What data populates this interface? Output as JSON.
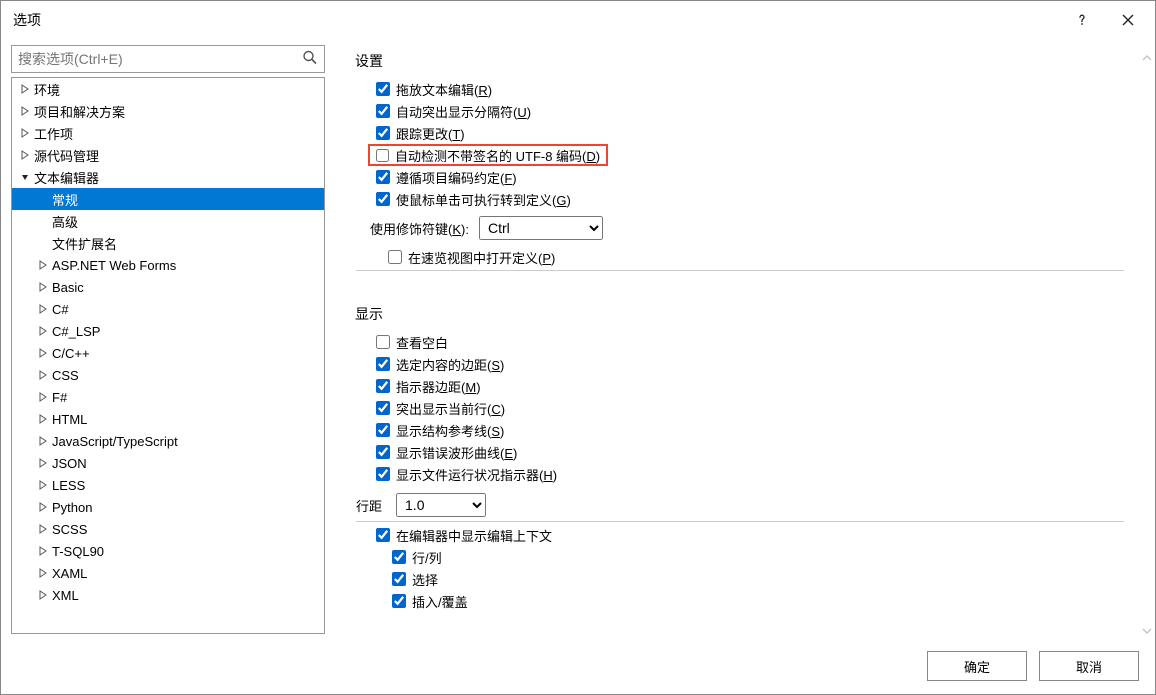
{
  "title": "选项",
  "search_placeholder": "搜索选项(Ctrl+E)",
  "tree": [
    {
      "label": "环境",
      "depth": 0,
      "expand": "closed"
    },
    {
      "label": "项目和解决方案",
      "depth": 0,
      "expand": "closed"
    },
    {
      "label": "工作项",
      "depth": 0,
      "expand": "closed"
    },
    {
      "label": "源代码管理",
      "depth": 0,
      "expand": "closed"
    },
    {
      "label": "文本编辑器",
      "depth": 0,
      "expand": "open"
    },
    {
      "label": "常规",
      "depth": 1,
      "expand": "none",
      "selected": true
    },
    {
      "label": "高级",
      "depth": 1,
      "expand": "none"
    },
    {
      "label": "文件扩展名",
      "depth": 1,
      "expand": "none"
    },
    {
      "label": "ASP.NET Web Forms",
      "depth": 1,
      "expand": "closed"
    },
    {
      "label": "Basic",
      "depth": 1,
      "expand": "closed"
    },
    {
      "label": "C#",
      "depth": 1,
      "expand": "closed"
    },
    {
      "label": "C#_LSP",
      "depth": 1,
      "expand": "closed"
    },
    {
      "label": "C/C++",
      "depth": 1,
      "expand": "closed"
    },
    {
      "label": "CSS",
      "depth": 1,
      "expand": "closed"
    },
    {
      "label": "F#",
      "depth": 1,
      "expand": "closed"
    },
    {
      "label": "HTML",
      "depth": 1,
      "expand": "closed"
    },
    {
      "label": "JavaScript/TypeScript",
      "depth": 1,
      "expand": "closed"
    },
    {
      "label": "JSON",
      "depth": 1,
      "expand": "closed"
    },
    {
      "label": "LESS",
      "depth": 1,
      "expand": "closed"
    },
    {
      "label": "Python",
      "depth": 1,
      "expand": "closed"
    },
    {
      "label": "SCSS",
      "depth": 1,
      "expand": "closed"
    },
    {
      "label": "T-SQL90",
      "depth": 1,
      "expand": "closed"
    },
    {
      "label": "XAML",
      "depth": 1,
      "expand": "closed"
    },
    {
      "label": "XML",
      "depth": 1,
      "expand": "closed"
    }
  ],
  "settings": {
    "title": "设置",
    "items": [
      {
        "text": "拖放文本编辑",
        "ak": "R",
        "checked": true
      },
      {
        "text": "自动突出显示分隔符",
        "ak": "U",
        "checked": true
      },
      {
        "text": "跟踪更改",
        "ak": "T",
        "checked": true
      },
      {
        "text": "自动检测不带签名的 UTF-8 编码",
        "ak": "D",
        "checked": false,
        "highlight": true
      },
      {
        "text": "遵循项目编码约定",
        "ak": "F",
        "checked": true
      },
      {
        "text": "使鼠标单击可执行转到定义",
        "ak": "G",
        "checked": true
      }
    ],
    "modifier_label": "使用修饰符键",
    "modifier_ak": "K",
    "modifier_value": "Ctrl",
    "peek": {
      "text": "在速览视图中打开定义",
      "ak": "P",
      "checked": false
    }
  },
  "display": {
    "title": "显示",
    "items": [
      {
        "text": "查看空白",
        "ak": "",
        "checked": false
      },
      {
        "text": "选定内容的边距",
        "ak": "S",
        "checked": true
      },
      {
        "text": "指示器边距",
        "ak": "M",
        "checked": true
      },
      {
        "text": "突出显示当前行",
        "ak": "C",
        "checked": true
      },
      {
        "text": "显示结构参考线",
        "ak": "S",
        "checked": true
      },
      {
        "text": "显示错误波形曲线",
        "ak": "E",
        "checked": true
      },
      {
        "text": "显示文件运行状况指示器",
        "ak": "H",
        "checked": true
      }
    ],
    "linespacing_label": "行距",
    "linespacing_value": "1.0",
    "context": {
      "text": "在编辑器中显示编辑上下文",
      "checked": true,
      "sub": [
        {
          "text": "行/列",
          "checked": true
        },
        {
          "text": "选择",
          "checked": true
        },
        {
          "text": "插入/覆盖",
          "checked": true
        }
      ]
    }
  },
  "buttons": {
    "ok": "确定",
    "cancel": "取消"
  }
}
